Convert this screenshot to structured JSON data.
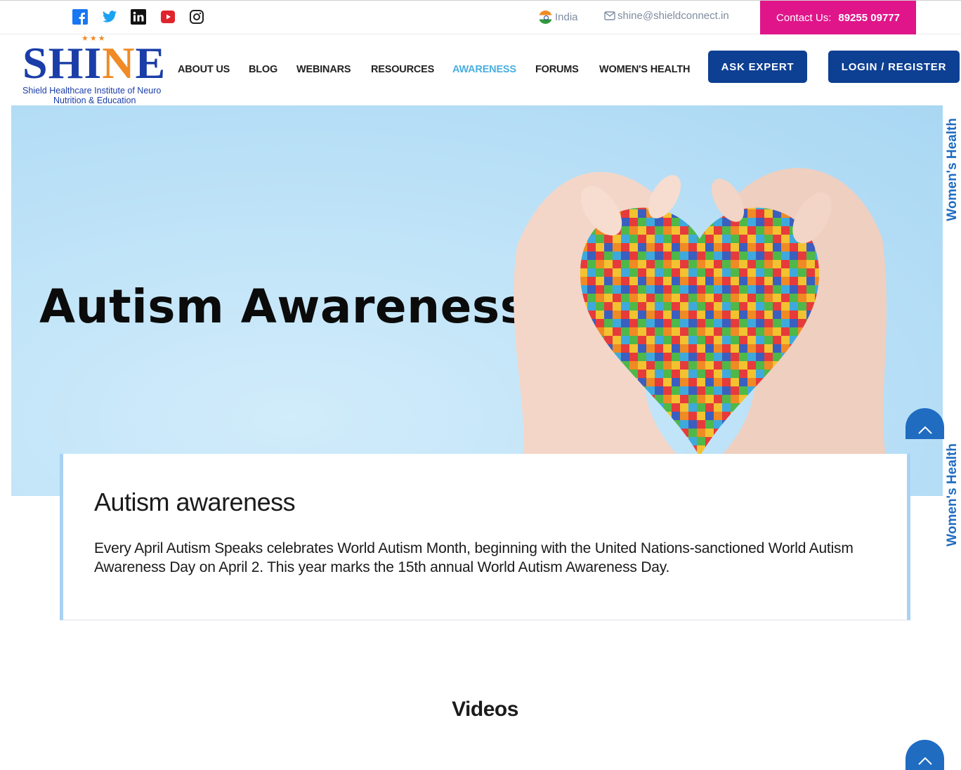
{
  "topbar": {
    "social_icons": [
      "facebook-icon",
      "twitter-icon",
      "linkedin-icon",
      "youtube-icon",
      "instagram-icon"
    ],
    "country": "India",
    "email": "shine@shieldconnect.in",
    "contact_label": "Contact Us:",
    "contact_number": "89255 09777"
  },
  "logo": {
    "word": "SHINE",
    "subtitle_line1": "Shield Healthcare Institute of Neuro",
    "subtitle_line2": "Nutrition & Education"
  },
  "nav": {
    "items": [
      {
        "label": "ABOUT US"
      },
      {
        "label": "BLOG"
      },
      {
        "label": "WEBINARS"
      },
      {
        "label": "RESOURCES"
      },
      {
        "label": "AWARENESS",
        "active": true
      },
      {
        "label": "FORUMS"
      },
      {
        "label": "WOMEN'S HEALTH"
      }
    ],
    "ask_expert": "ASK EXPERT",
    "login_register": "LOGIN / REGISTER"
  },
  "hero": {
    "title": "Autism Awareness"
  },
  "side_tab": {
    "label": "Women's Health"
  },
  "article": {
    "heading": "Autism awareness",
    "body": "Every April Autism Speaks celebrates World Autism Month, beginning with the United Nations-sanctioned World Autism Awareness Day on April 2. This year marks the 15th annual World Autism Awareness Day."
  },
  "videos": {
    "title": "Videos"
  },
  "colors": {
    "brand_blue": "#0d3f93",
    "contact_pink": "#e0158a",
    "active_nav": "#4aafe0",
    "side_tab_text": "#1f6cc1",
    "logo_orange": "#f08a24"
  }
}
